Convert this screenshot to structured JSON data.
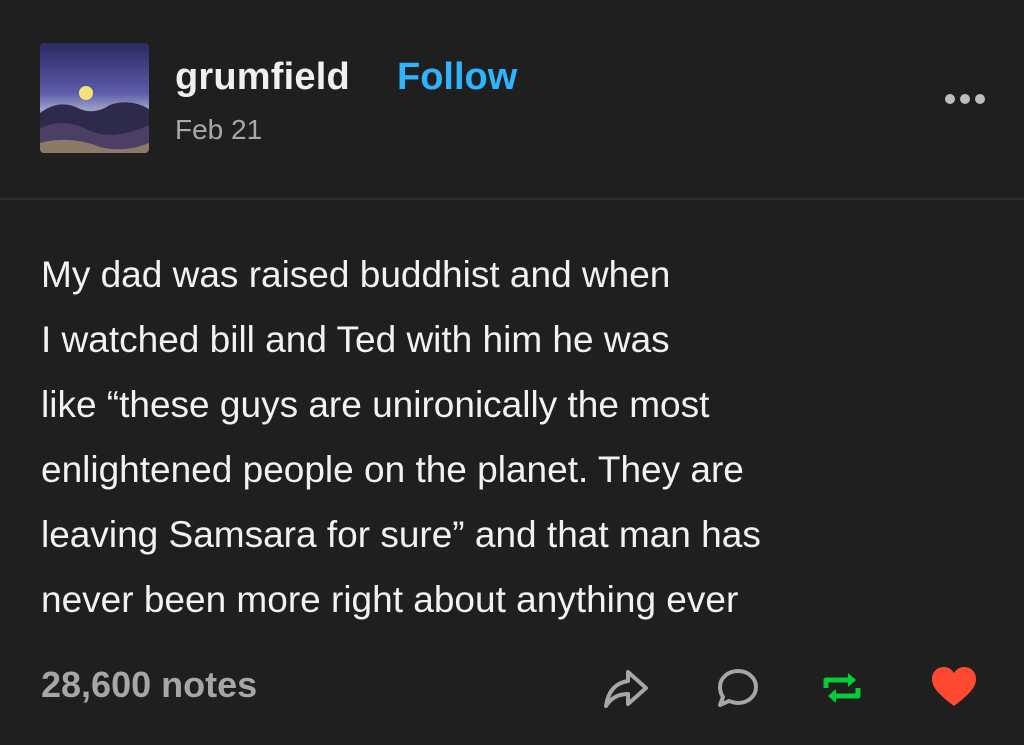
{
  "post": {
    "author": {
      "username": "grumfield",
      "follow_label": "Follow",
      "date": "Feb 21"
    },
    "body_lines": [
      "My dad was raised buddhist and when",
      "I watched bill and Ted with him he was",
      "like “these guys are unironically the most",
      "enlightened people on the planet. They are",
      "leaving Samsara for sure” and that man has",
      "never been more right about anything ever"
    ],
    "footer": {
      "notes": "28,600 notes",
      "actions": [
        "share-icon",
        "reply-icon",
        "reblog-icon",
        "like-icon"
      ]
    }
  },
  "colors": {
    "background": "#1f1f1f",
    "text": "#f2f2f2",
    "follow": "#2fb4ff",
    "muted": "#a6a6a6",
    "reblog": "#00cf35",
    "like": "#ff4930"
  }
}
